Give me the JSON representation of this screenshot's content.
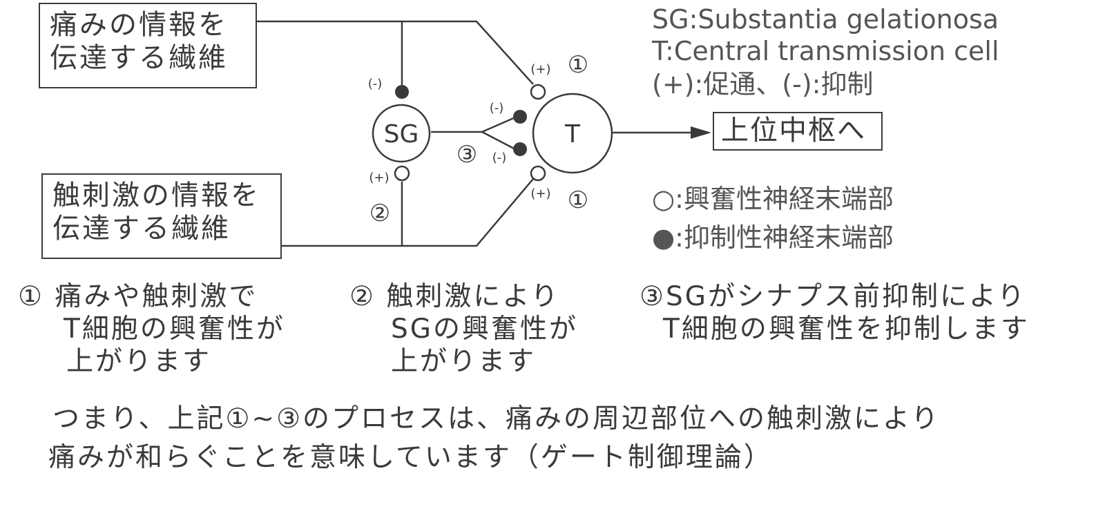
{
  "boxes": {
    "pain_fiber": [
      "痛みの情報を",
      "伝達する繊維"
    ],
    "touch_fiber": [
      "触刺激の情報を",
      "伝達する繊維"
    ]
  },
  "legend": {
    "sg_def": "SG:Substantia gelationosa",
    "t_def": "T:Central transmission cell",
    "sign_def": "(+):促通、(-):抑制"
  },
  "to_higher_center": "上位中枢へ",
  "nodes": {
    "sg": "SG",
    "t": "T"
  },
  "signs": {
    "plus": "(+)",
    "minus": "(-)"
  },
  "markers": {
    "one": "①",
    "two": "②",
    "three": "③"
  },
  "terminal_legend": {
    "open": "○:興奮性神経末端部",
    "filled": "●:抑制性神経末端部"
  },
  "notes": {
    "n1": [
      "① 痛みや触刺激で",
      "T細胞の興奮性が",
      "上がります"
    ],
    "n2": [
      "② 触刺激により",
      "SGの興奮性が",
      "上がります"
    ],
    "n3": [
      "③SGがシナプス前抑制により",
      "T細胞の興奮性を抑制します"
    ]
  },
  "summary": [
    "つまり、上記①~③のプロセスは、痛みの周辺部位への触刺激により",
    "痛みが和らぐことを意味しています（ゲート制御理論）"
  ],
  "colors": {
    "line": "#3a3a3a",
    "text": "#3a3a3a",
    "legend_text": "#555555"
  }
}
